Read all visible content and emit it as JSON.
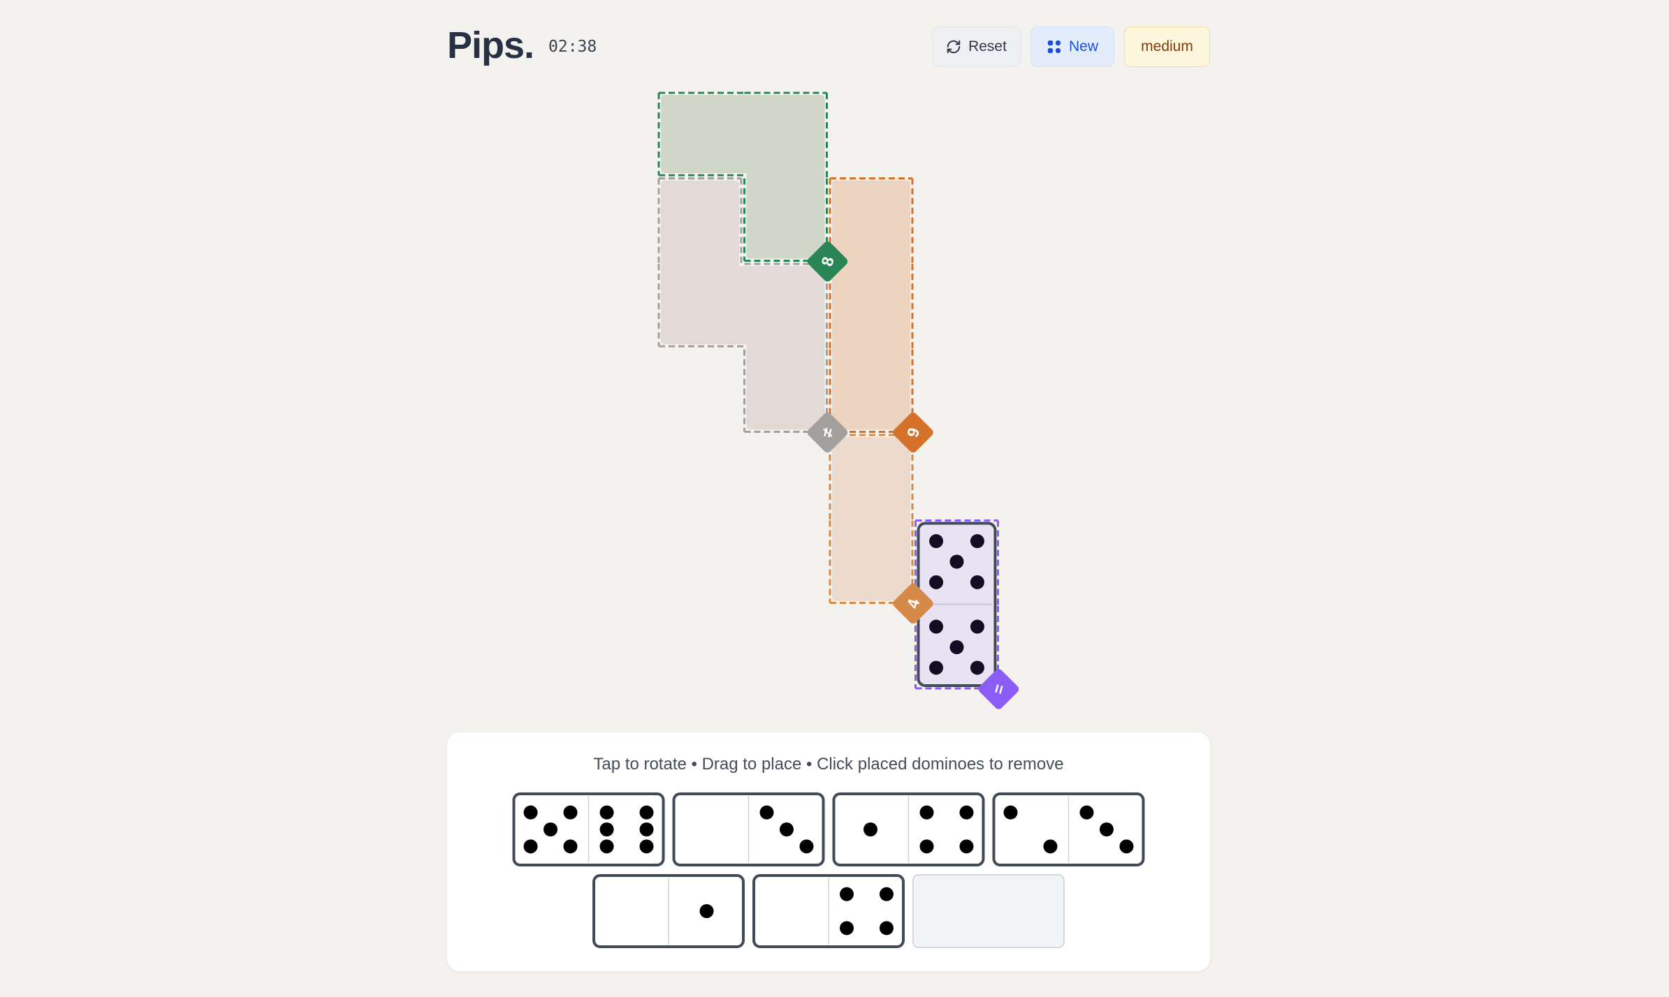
{
  "header": {
    "title": "Pips.",
    "timer": "02:38",
    "reset_label": "Reset",
    "new_label": "New",
    "difficulty_label": "medium"
  },
  "board": {
    "regions": [
      {
        "name": "green",
        "color": "#2a8556",
        "fill": "#d1d7c8",
        "label": "8",
        "cells": [
          [
            0,
            0
          ],
          [
            0,
            1
          ],
          [
            1,
            1
          ]
        ]
      },
      {
        "name": "gray",
        "color": "#a29f9d",
        "fill": "#e3dad5",
        "label": "≠",
        "cells": [
          [
            1,
            0
          ],
          [
            2,
            0
          ],
          [
            2,
            1
          ],
          [
            3,
            1
          ]
        ]
      },
      {
        "name": "orange",
        "color": "#d4712b",
        "fill": "#edd4c0",
        "label": "9",
        "cells": [
          [
            1,
            2
          ],
          [
            2,
            2
          ],
          [
            3,
            2
          ]
        ]
      },
      {
        "name": "tan",
        "color": "#d68a4a",
        "fill": "#ecdacc",
        "label": "4",
        "cells": [
          [
            4,
            2
          ],
          [
            5,
            2
          ]
        ]
      },
      {
        "name": "purple",
        "color": "#8b5cf6",
        "fill": "#e9e2f3",
        "label": "=",
        "cells": [
          [
            5,
            3
          ],
          [
            6,
            3
          ]
        ]
      }
    ],
    "placed_dominoes": [
      {
        "cells": [
          [
            5,
            3
          ],
          [
            6,
            3
          ]
        ],
        "pips": [
          5,
          5
        ]
      }
    ]
  },
  "tray": {
    "hint": "Tap to rotate • Drag to place • Click placed dominoes to remove",
    "dominoes": [
      {
        "pips": [
          5,
          6
        ]
      },
      {
        "pips": [
          0,
          3
        ]
      },
      {
        "pips": [
          1,
          4
        ]
      },
      {
        "pips": [
          2,
          3
        ]
      },
      {
        "pips": [
          0,
          1
        ]
      },
      {
        "pips": [
          0,
          4
        ]
      },
      {
        "pips": null
      }
    ]
  },
  "colors": {
    "background": "#f4f2ef",
    "accent_blue": "#1d4ed8",
    "domino_border": "#414a57",
    "pip": "#000000",
    "placed_pip": "#120d22"
  }
}
